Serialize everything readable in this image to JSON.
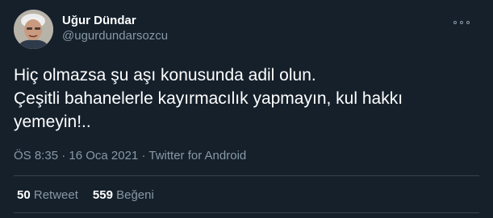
{
  "author": {
    "display_name": "Uğur Dündar",
    "handle": "@ugurdundarsozcu",
    "avatar_icon": "user-avatar-photo"
  },
  "tweet": {
    "lines": [
      "Hiç olmazsa şu aşı konusunda adil olun.",
      "Çeşitli bahanelerle kayırmacılık yapmayın, kul hakkı",
      "yemeyin!.."
    ]
  },
  "meta": {
    "time": "ÖS 8:35",
    "date": "16 Oca 2021",
    "source": "Twitter for Android",
    "separator": " · "
  },
  "stats": {
    "retweets_count": "50",
    "retweets_label": "Retweet",
    "likes_count": "559",
    "likes_label": "Beğeni"
  },
  "colors": {
    "background": "#15202b",
    "primary_text": "#ffffff",
    "secondary_text": "#8899a6",
    "divider": "#38444d"
  },
  "icons": {
    "more": "more-horizontal-icon"
  }
}
